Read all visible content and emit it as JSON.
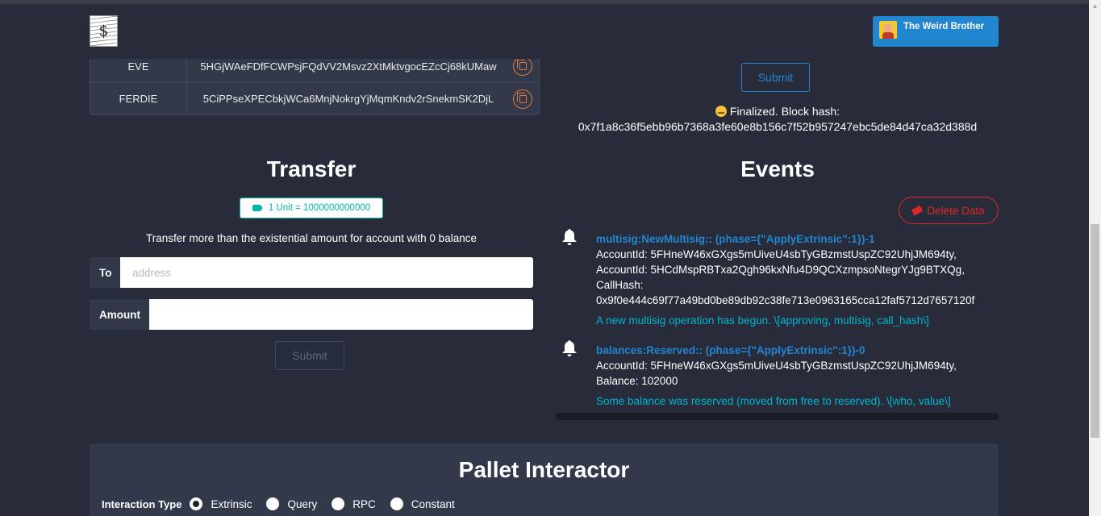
{
  "header": {
    "account_name": "The Weird Brother",
    "logo_alt": "app-logo"
  },
  "accounts": [
    {
      "name": "EVE",
      "address": "5HGjWAeFDfFCWPsjFQdVV2Msvz2XtMktvgocEZcCj68kUMaw"
    },
    {
      "name": "FERDIE",
      "address": "5CiPPseXPECbkjWCa6MnjNokrgYjMqmKndv2rSnekmSK2DjL"
    }
  ],
  "top_form": {
    "submit_label": "Submit",
    "status_text": "Finalized. Block hash:",
    "block_hash": "0x7f1a8c36f5ebb96b7368a3fe60e8b156c7f52b957247ebc5de84d47ca32d388d"
  },
  "transfer": {
    "title": "Transfer",
    "unit_label": "1 Unit = 1000000000000",
    "description": "Transfer more than the existential amount for account with 0 balance",
    "to_label": "To",
    "to_placeholder": "address",
    "amount_label": "Amount",
    "amount_value": "",
    "submit_label": "Submit"
  },
  "events": {
    "title": "Events",
    "delete_label": "Delete Data",
    "items": [
      {
        "summary": "multisig:NewMultisig:: (phase={\"ApplyExtrinsic\":1})-1",
        "lines": [
          "AccountId: 5FHneW46xGXgs5mUiveU4sbTyGBzmstUspZC92UhjJM694ty,",
          "AccountId: 5HCdMspRBTxa2Qgh96kxNfu4D9QCXzmpsoNtegrYJg9BTXQg,",
          "CallHash:",
          "0x9f0e444c69f77a49bd0be89db92c38fe713e0963165cca12faf5712d7657120f"
        ],
        "doc": "A new multisig operation has begun. \\[approving, multisig, call_hash\\]"
      },
      {
        "summary": "balances:Reserved:: (phase={\"ApplyExtrinsic\":1})-0",
        "lines": [
          "AccountId: 5FHneW46xGXgs5mUiveU4sbTyGBzmstUspZC92UhjJM694ty,",
          "Balance: 102000"
        ],
        "doc": "Some balance was reserved (moved from free to reserved). \\[who, value\\]"
      }
    ]
  },
  "pallet": {
    "title": "Pallet Interactor",
    "interaction_label": "Interaction Type",
    "options": [
      "Extrinsic",
      "Query",
      "RPC",
      "Constant"
    ],
    "selected": "Extrinsic"
  },
  "colors": {
    "background": "#282c3a",
    "primary": "#2185d0",
    "teal": "#00b5ad",
    "danger": "#db2828",
    "copy_accent": "#e07b39"
  }
}
